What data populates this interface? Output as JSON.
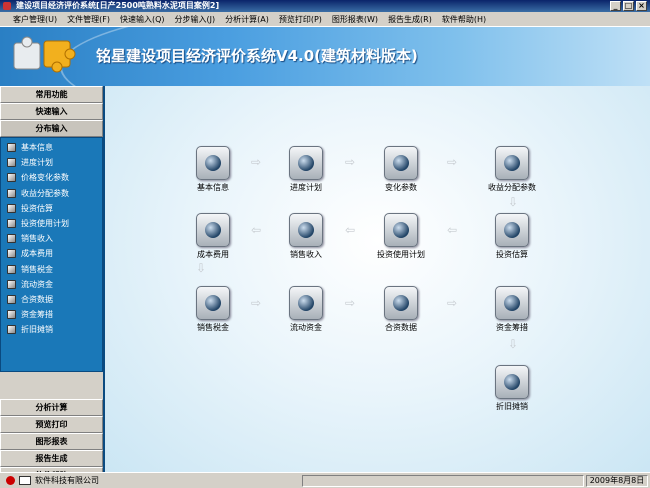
{
  "window": {
    "title": "建设项目经济评价系统[日产2500吨熟料水泥项目案例2]"
  },
  "menu": [
    "客户管理(U)",
    "文件管理(F)",
    "快速输入(Q)",
    "分步输入(J)",
    "分析计算(A)",
    "预览打印(P)",
    "图形报表(W)",
    "报告生成(R)",
    "软件帮助(H)"
  ],
  "banner": {
    "title": "铭星建设项目经济评价系统V4.0(建筑材料版本)"
  },
  "sidebar": {
    "top": [
      "常用功能",
      "快速输入",
      "分布输入"
    ],
    "items": [
      "基本信息",
      "进度计划",
      "价格变化参数",
      "收益分配参数",
      "投资估算",
      "投资使用计划",
      "销售收入",
      "成本费用",
      "销售税金",
      "流动资金",
      "合资数据",
      "资金筹措",
      "折旧摊销"
    ],
    "bottom": [
      "分析计算",
      "预览打印",
      "图形报表",
      "报告生成",
      "软件帮助"
    ]
  },
  "flow": {
    "nodes": [
      "基本信息",
      "进度计划",
      "变化参数",
      "收益分配参数",
      "成本费用",
      "销售收入",
      "投资使用计划",
      "投资估算",
      "销售税金",
      "流动资金",
      "合资数据",
      "资金筹措",
      "折旧摊销"
    ]
  },
  "status": {
    "company": "软件科技有限公司",
    "date": "2009年8月8日"
  }
}
